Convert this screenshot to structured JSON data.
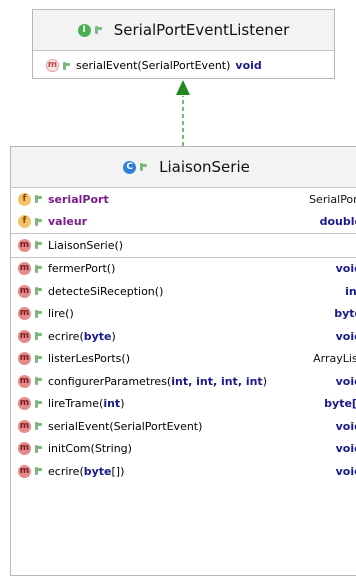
{
  "interface": {
    "badge": "I",
    "name": "SerialPortEventListener",
    "method": {
      "badge": "m",
      "name": "serialEvent(SerialPortEvent)",
      "return": "void"
    }
  },
  "class": {
    "badge": "C",
    "name": "LiaisonSerie",
    "fields": [
      {
        "badge": "f",
        "name": "serialPort",
        "type": "SerialPort"
      },
      {
        "badge": "f",
        "name": "valeur",
        "type": "double"
      }
    ],
    "constructors": [
      {
        "badge": "m",
        "name": "LiaisonSerie()"
      }
    ],
    "methods": [
      {
        "badge": "m",
        "pre": "fermerPort()",
        "arg": "",
        "post": "",
        "type": "void"
      },
      {
        "badge": "m",
        "pre": "detecteSiReception()",
        "arg": "",
        "post": "",
        "type": "int"
      },
      {
        "badge": "m",
        "pre": "lire()",
        "arg": "",
        "post": "",
        "type": "byte"
      },
      {
        "badge": "m",
        "pre": "ecrire(",
        "arg": "byte",
        "post": ")",
        "type": "void"
      },
      {
        "badge": "m",
        "pre": "listerLesPorts()",
        "arg": "",
        "post": "",
        "type": "ArrayList"
      },
      {
        "badge": "m",
        "pre": "configurerParametres(",
        "arg": "int, int, int, int",
        "post": ")",
        "type": "void"
      },
      {
        "badge": "m",
        "pre": "lireTrame(",
        "arg": "int",
        "post": ")",
        "type": "byte[]"
      },
      {
        "badge": "m",
        "pre": "serialEvent(SerialPortEvent)",
        "arg": "",
        "post": "",
        "type": "void"
      },
      {
        "badge": "m",
        "pre": "initCom(String)",
        "arg": "",
        "post": "",
        "type": "void"
      },
      {
        "badge": "m",
        "pre": "ecrire(",
        "arg": "byte",
        "post": "[])",
        "type": "void"
      }
    ]
  },
  "colors": {
    "implements_arrow": "#1e8a1e",
    "keyword": "#1a1a8c"
  }
}
